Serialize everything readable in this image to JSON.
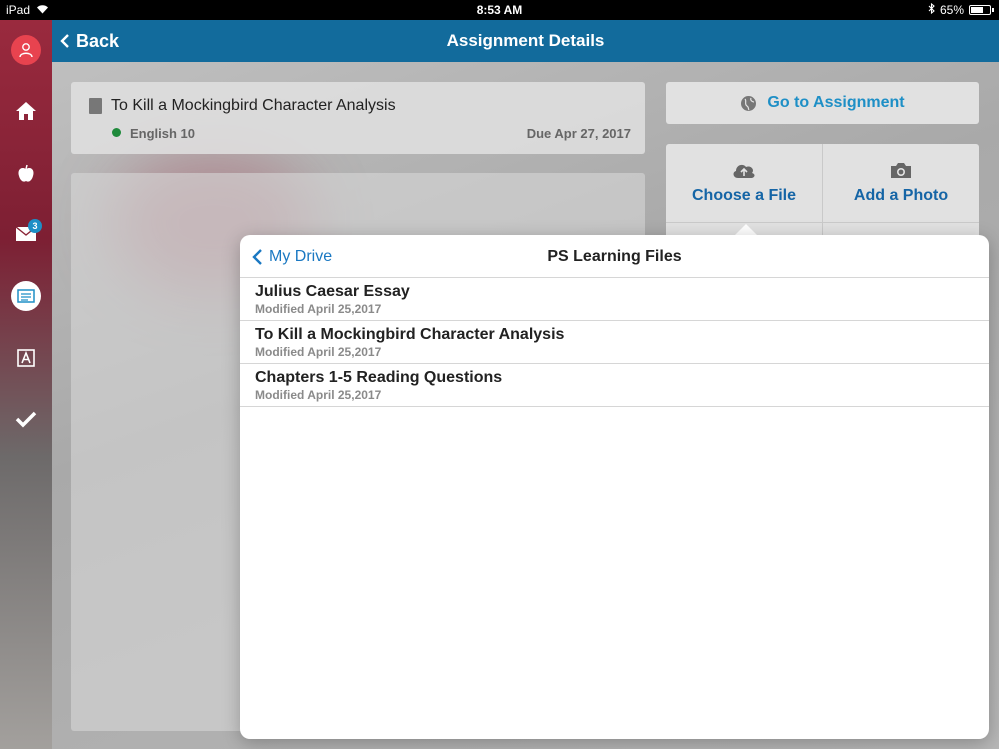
{
  "status_bar": {
    "device": "iPad",
    "time": "8:53 AM",
    "battery": "65%",
    "battery_fraction": 0.65
  },
  "sidebar": {
    "mail_badge": "3"
  },
  "navbar": {
    "back_label": "Back",
    "title": "Assignment Details"
  },
  "assignment": {
    "title": "To Kill a Mockingbird Character Analysis",
    "class_name": "English 10",
    "due": "Due Apr 27, 2017",
    "status_color": "#1f8a3b"
  },
  "actions": {
    "go_label": "Go to Assignment",
    "choose_file_label": "Choose a File",
    "add_photo_label": "Add a Photo"
  },
  "file_picker": {
    "back_label": "My Drive",
    "title": "PS Learning Files",
    "files": [
      {
        "name": "Julius Caesar Essay",
        "modified": "Modified April 25,2017"
      },
      {
        "name": "To Kill a Mockingbird Character Analysis",
        "modified": "Modified April 25,2017"
      },
      {
        "name": "Chapters 1-5 Reading Questions",
        "modified": "Modified April 25,2017"
      }
    ]
  },
  "colors": {
    "navbar": "#126b9c",
    "accent": "#1e8fc6",
    "avatar": "#e8434f"
  }
}
